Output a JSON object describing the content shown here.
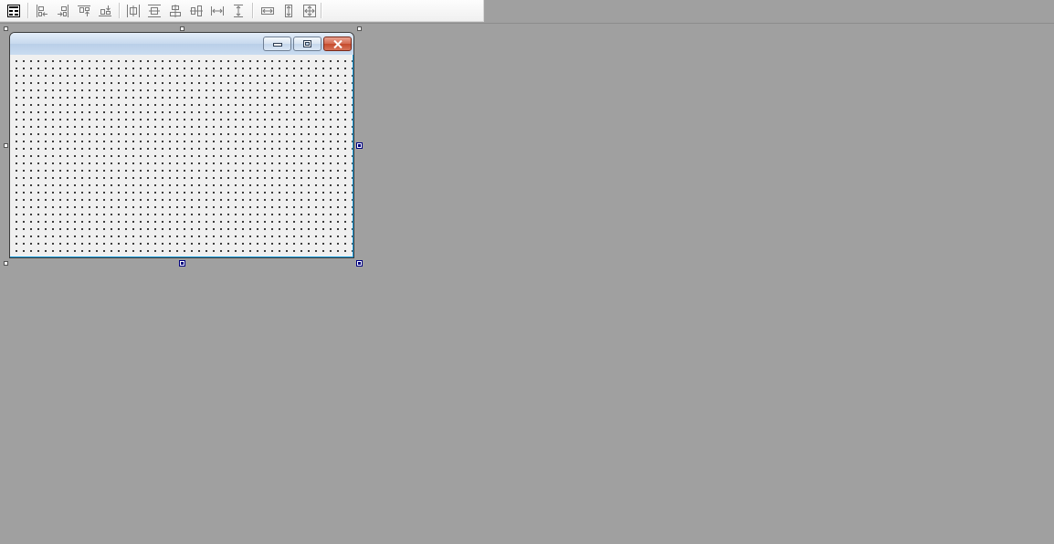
{
  "toolbar": {
    "buttons": [
      {
        "name": "tab-order-icon",
        "group": 0
      },
      {
        "name": "align-lefts-icon",
        "group": 1
      },
      {
        "name": "align-rights-icon",
        "group": 1
      },
      {
        "name": "align-tops-icon",
        "group": 1
      },
      {
        "name": "align-bottoms-icon",
        "group": 1
      },
      {
        "name": "center-horizontally-icon",
        "group": 2
      },
      {
        "name": "center-vertically-icon",
        "group": 2
      },
      {
        "name": "align-centers-icon",
        "group": 2
      },
      {
        "name": "align-middles-icon",
        "group": 2
      },
      {
        "name": "space-across-icon",
        "group": 2
      },
      {
        "name": "space-down-icon",
        "group": 2
      },
      {
        "name": "make-same-width-icon",
        "group": 3
      },
      {
        "name": "make-same-height-icon",
        "group": 3
      },
      {
        "name": "make-same-size-icon",
        "group": 3
      }
    ]
  },
  "form": {
    "caption": "",
    "caption_buttons": [
      "minimize-icon",
      "maximize-icon",
      "close-icon"
    ],
    "selected": true,
    "grid_visible": true
  },
  "colors": {
    "workspace": "#a0a0a0",
    "selection_handle": "#000080",
    "close_button": "#c44a2c"
  }
}
